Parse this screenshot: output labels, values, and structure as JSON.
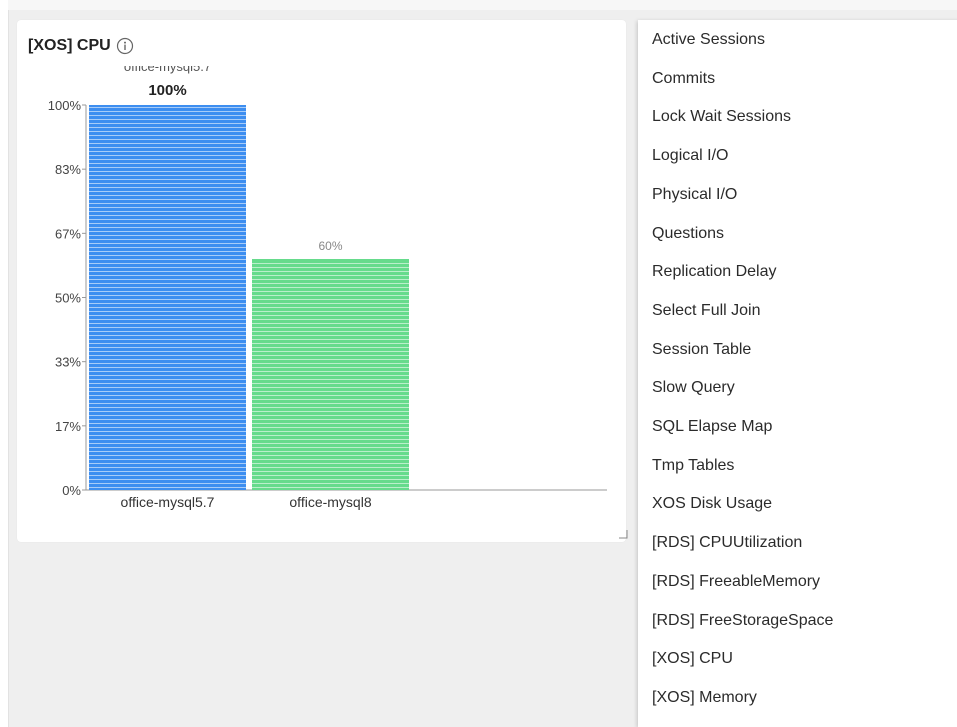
{
  "widget": {
    "title": "[XOS] CPU",
    "info_icon": "info-circle-icon",
    "resize_icon": "resize-corner-icon"
  },
  "chart_data": {
    "type": "bar",
    "categories": [
      "office-mysql5.7",
      "office-mysql8"
    ],
    "values": [
      100,
      60
    ],
    "value_labels": [
      "100%",
      "60%"
    ],
    "top_label": "office-mysql5.7",
    "colors": [
      "#3d8ef0",
      "#66db8c"
    ],
    "ylim": [
      0,
      100
    ],
    "yticks": [
      "0%",
      "17%",
      "33%",
      "50%",
      "67%",
      "83%",
      "100%"
    ],
    "xlabel": "",
    "ylabel": "",
    "grid": false,
    "legend": "none"
  },
  "menu": {
    "items": [
      {
        "label": "Active Sessions"
      },
      {
        "label": "Commits"
      },
      {
        "label": "Lock Wait Sessions"
      },
      {
        "label": "Logical I/O"
      },
      {
        "label": "Physical I/O"
      },
      {
        "label": "Questions"
      },
      {
        "label": "Replication Delay"
      },
      {
        "label": "Select Full Join"
      },
      {
        "label": "Session Table"
      },
      {
        "label": "Slow Query"
      },
      {
        "label": "SQL Elapse Map"
      },
      {
        "label": "Tmp Tables"
      },
      {
        "label": "XOS Disk Usage"
      },
      {
        "label": "[RDS] CPUUtilization"
      },
      {
        "label": "[RDS] FreeableMemory"
      },
      {
        "label": "[RDS] FreeStorageSpace"
      },
      {
        "label": "[XOS] CPU"
      },
      {
        "label": "[XOS] Memory"
      }
    ]
  }
}
